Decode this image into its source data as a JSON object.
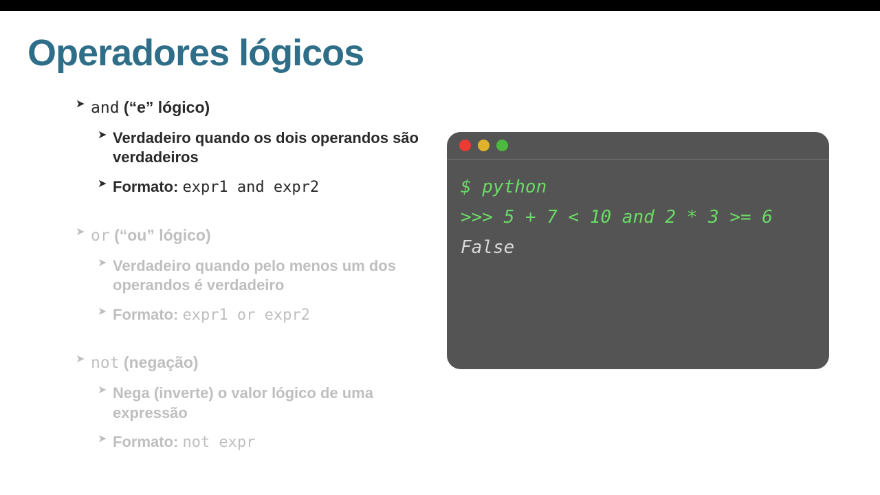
{
  "title": "Operadores lógicos",
  "andSection": {
    "head_mono": "and",
    "head_rest": " (“e” lógico)",
    "line1": "Verdadeiro quando os dois operandos são verdadeiros",
    "line2_label": "Formato: ",
    "line2_expr": "expr1 and expr2"
  },
  "orSection": {
    "head_mono": "or",
    "head_rest": " (“ou” lógico)",
    "line1": "Verdadeiro quando pelo menos um dos operandos é verdadeiro",
    "line2_label": "Formato: ",
    "line2_expr": "expr1 or expr2"
  },
  "notSection": {
    "head_mono": "not",
    "head_rest": " (negação)",
    "line1": "Nega (inverte) o valor lógico de uma expressão",
    "line2_label": "Formato: ",
    "line2_expr": "not expr"
  },
  "terminal": {
    "python": "$ python",
    "input": ">>> 5 + 7 < 10 and 2 * 3 >= 6",
    "output": "False"
  }
}
